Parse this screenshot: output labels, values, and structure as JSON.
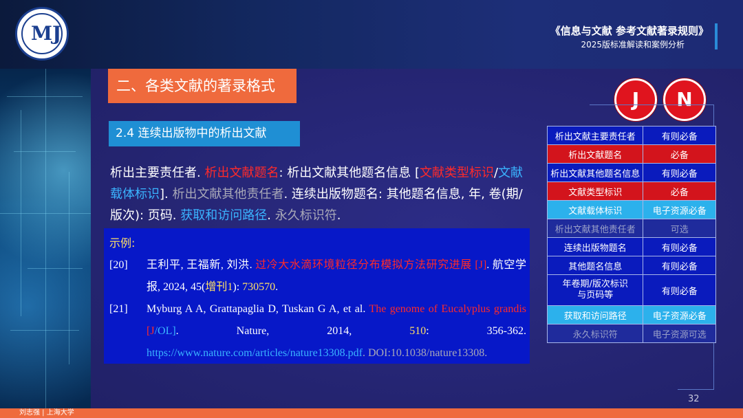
{
  "header": {
    "title": "《信息与文献  参考文献著录规则》",
    "subtitle": "2025版标准解读和案例分析",
    "logo_icon": "university-seal-icon"
  },
  "section_title": "二、各类文献的著录格式",
  "subsection_title": "2.4  连续出版物中的析出文献",
  "format": {
    "p1": "析出主要责任者. ",
    "p2": "析出文献题名",
    "p3": ": 析出文献其他题名信息  [",
    "p4": "文献类型标识",
    "p5": "/",
    "p6": "文献载体标识",
    "p7": "]. ",
    "p8": "析出文献其他责任者",
    "p9": ". 连续出版物题名: 其他题名信息, 年, 卷(期/版次): 页码. ",
    "p10": "获取和访问路径",
    "p11": ". ",
    "p12": "永久标识符",
    "p13": "."
  },
  "example": {
    "label": "示例:",
    "ref1": {
      "num": "[20]",
      "a": "王利平, 王福新, 刘洪. ",
      "b": "过冷大水滴环境粒径分布模拟方法研究进展  [J]",
      "c": ". 航空学报, 2024, 45(",
      "d": "增刊1",
      "e": "): ",
      "f": "730570",
      "g": "."
    },
    "ref2": {
      "num": "[21]",
      "a": "Myburg A A, Grattapaglia D, Tuskan G A, et al. ",
      "b": "The genome of Eucalyplus grandis [J",
      "c": "/OL]",
      "d": ". Nature, 2014, ",
      "e": "510",
      "f": ": 356-362. ",
      "g": "https://www.nature.com/articles/nature13308.pdf",
      "h": ". DOI:10.1038/nature13308."
    }
  },
  "badges": [
    "J",
    "N"
  ],
  "table": {
    "rows": [
      {
        "field": "析出文献主要责任者",
        "req": "有则必备",
        "style": "norm"
      },
      {
        "field": "析出文献题名",
        "req": "必备",
        "style": "red"
      },
      {
        "field": "析出文献其他题名信息",
        "req": "有则必备",
        "style": "norm"
      },
      {
        "field": "文献类型标识",
        "req": "必备",
        "style": "red"
      },
      {
        "field": "文献载体标识",
        "req": "电子资源必备",
        "style": "cyan"
      },
      {
        "field": "析出文献其他责任者",
        "req": "可选",
        "style": "gray"
      },
      {
        "field": "连续出版物题名",
        "req": "有则必备",
        "style": "norm"
      },
      {
        "field": "其他题名信息",
        "req": "有则必备",
        "style": "norm"
      },
      {
        "field": "年卷期/版次标识\n与页码等",
        "req": "有则必备",
        "style": "norm"
      },
      {
        "field": "获取和访问路径",
        "req": "电子资源必备",
        "style": "cyan"
      },
      {
        "field": "永久标识符",
        "req": "电子资源可选",
        "style": "gray"
      }
    ]
  },
  "colors": {
    "accent_orange": "#ef6a3d",
    "accent_blue": "#1f8fd4",
    "required_red": "#d3141c",
    "electronic_cyan": "#2cb1ec"
  },
  "page_number": "32",
  "footer": "刘志强 | 上海大学"
}
